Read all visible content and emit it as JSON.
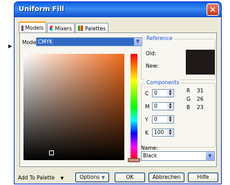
{
  "window": {
    "title": "Uniform Fill"
  },
  "tabs": [
    {
      "label": "Models",
      "active": true
    },
    {
      "label": "Mixers",
      "active": false
    },
    {
      "label": "Palettes",
      "active": false
    }
  ],
  "model": {
    "label": "Model:",
    "value": "CMYK"
  },
  "reference": {
    "title": "Reference",
    "old_label": "Old:",
    "new_label": "New:",
    "old_color": "#1f1a17"
  },
  "components": {
    "title": "Components",
    "cmyk": [
      {
        "label": "C",
        "value": "0"
      },
      {
        "label": "M",
        "value": "0"
      },
      {
        "label": "Y",
        "value": "0"
      },
      {
        "label": "K",
        "value": "100"
      }
    ],
    "rgb": [
      {
        "label": "R",
        "value": "31"
      },
      {
        "label": "G",
        "value": "26"
      },
      {
        "label": "B",
        "value": "23"
      }
    ]
  },
  "name": {
    "label": "Name:",
    "value": "Black"
  },
  "footer": {
    "add_to_palette": "Add To Palette",
    "options": "Options",
    "ok": "OK",
    "cancel": "Abbrechen",
    "help": "Hilfe"
  },
  "colors": {
    "accent": "#316ac5",
    "titlebar": "#0a5fe0",
    "close": "#c8391a"
  },
  "icons": {
    "close": "close-icon",
    "models": "models-icon",
    "mixers": "mixers-icon",
    "palettes": "palettes-icon"
  }
}
